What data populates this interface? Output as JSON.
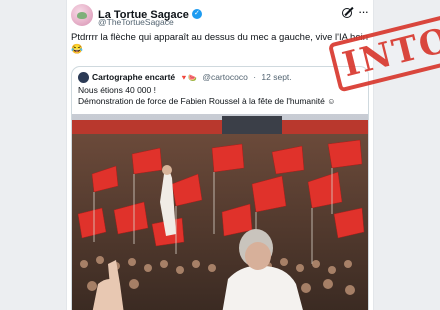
{
  "tweet": {
    "display_name": "La Tortue Sagace",
    "handle": "@TheTortueSagace",
    "text": "Ptdrrrr la flèche qui apparaît au dessus du mec a gauche, vive l'IA hein",
    "text_emoji": "😂"
  },
  "quoted": {
    "display_name": "Cartographe encarté",
    "name_emoji": "🔻🍉",
    "handle": "@cartococo",
    "separator": "·",
    "date": "12 sept.",
    "line1": "Nous étions 40 000 !",
    "line2": "Démonstration de force de Fabien Roussel à la fête de l'humanité",
    "line2_emoji": "☺"
  },
  "stamp": {
    "text": "INTOX",
    "color": "#d8382e"
  },
  "colors": {
    "verified": "#1d9bf0",
    "text": "#0f1419",
    "secondary": "#536471",
    "flag": "#e0322b"
  },
  "icons": {
    "verified": "verified-badge-icon",
    "grok": "grok-icon",
    "more": "more-icon"
  }
}
